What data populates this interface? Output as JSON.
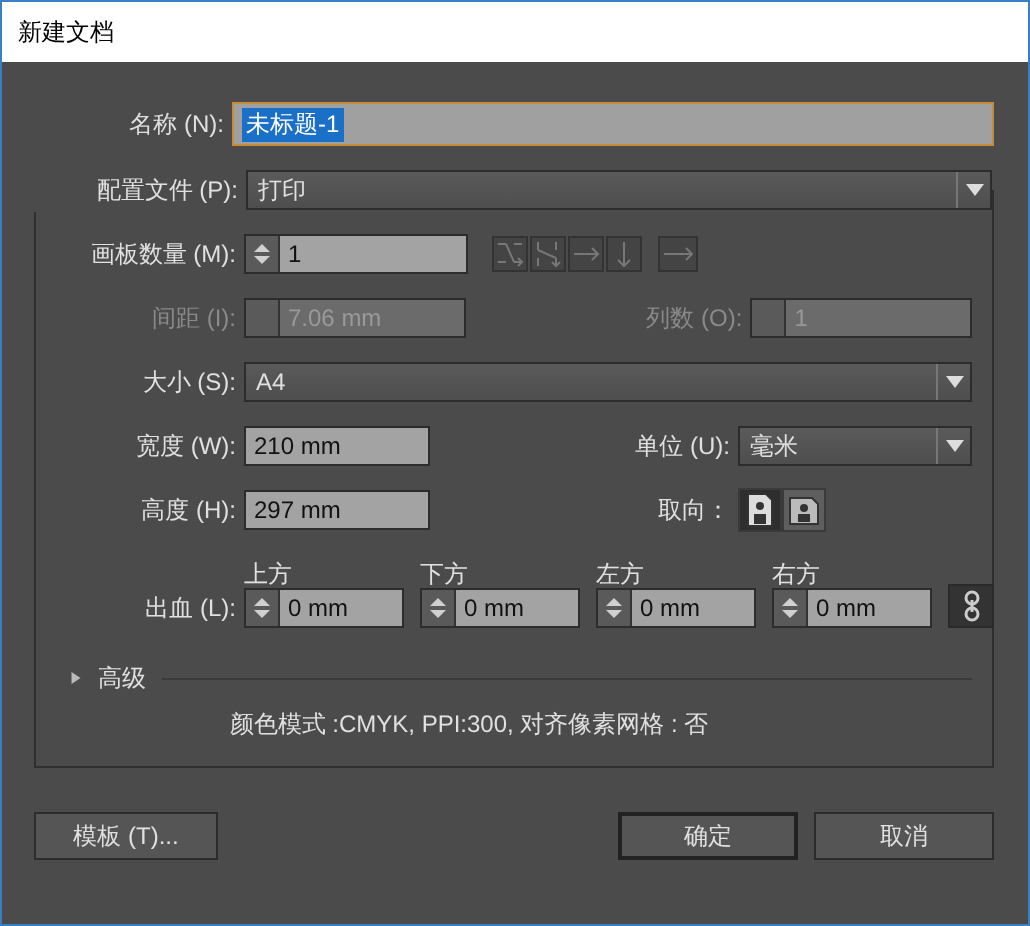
{
  "window": {
    "title": "新建文档"
  },
  "name": {
    "label": "名称 (N):",
    "value": "未标题-1"
  },
  "profile": {
    "label": "配置文件 (P):",
    "value": "打印"
  },
  "artboards": {
    "label": "画板数量 (M):",
    "value": "1"
  },
  "spacing": {
    "label": "间距 (I):",
    "value": "7.06 mm",
    "disabled": true
  },
  "columns": {
    "label": "列数 (O):",
    "value": "1",
    "disabled": true
  },
  "size": {
    "label": "大小 (S):",
    "value": "A4"
  },
  "width": {
    "label": "宽度 (W):",
    "value": "210 mm"
  },
  "units": {
    "label": "单位 (U):",
    "value": "毫米"
  },
  "height": {
    "label": "高度 (H):",
    "value": "297 mm"
  },
  "orientation": {
    "label": "取向：",
    "options": [
      {
        "kind": "portrait",
        "selected": true
      },
      {
        "kind": "landscape",
        "selected": false
      }
    ]
  },
  "bleed": {
    "label": "出血 (L):",
    "fields": [
      {
        "label": "上方",
        "value": "0 mm"
      },
      {
        "label": "下方",
        "value": "0 mm"
      },
      {
        "label": "左方",
        "value": "0 mm"
      },
      {
        "label": "右方",
        "value": "0 mm"
      }
    ]
  },
  "advanced": {
    "label": "高级",
    "expanded": false
  },
  "summary": "颜色模式 :CMYK, PPI:300, 对齐像素网格 : 否",
  "buttons": [
    {
      "label": "模板 (T)...",
      "default": false
    },
    {
      "label": "确定",
      "default": true
    },
    {
      "label": "取消",
      "default": false
    }
  ]
}
